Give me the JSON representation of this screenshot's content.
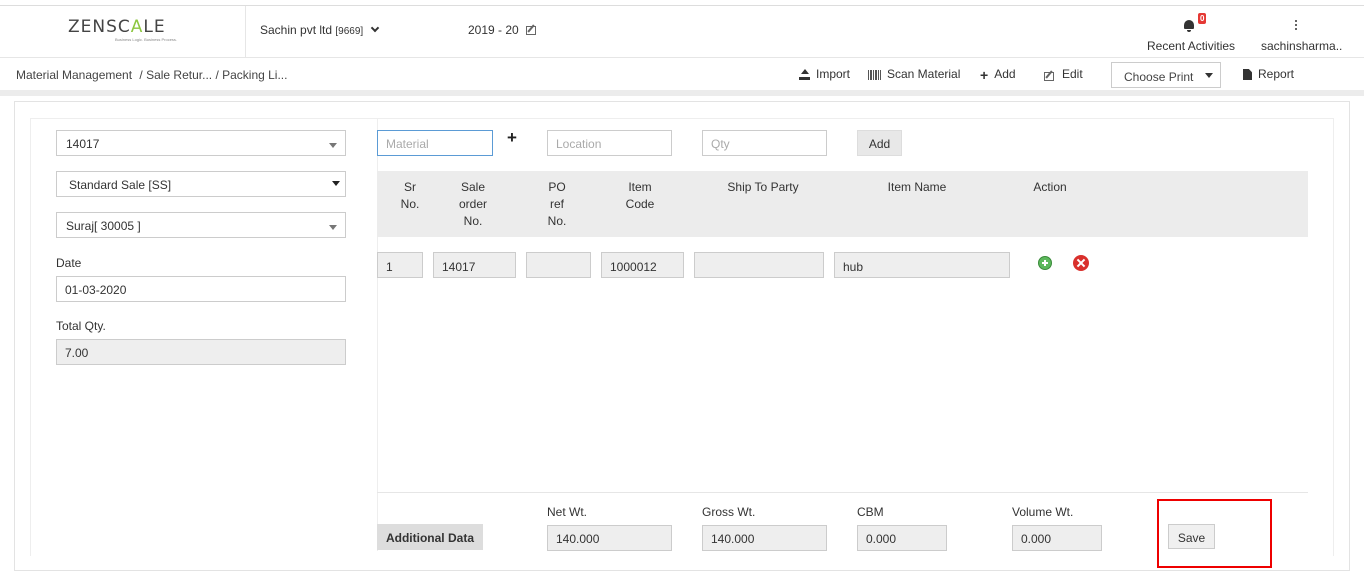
{
  "header": {
    "logo": {
      "part1": "ZENSC",
      "part2": "A",
      "part3": "LE",
      "tagline": "Business Logic. Business Process."
    },
    "company": {
      "name": "Sachin pvt ltd",
      "code": "[9669]"
    },
    "financial_year": "2019 - 20",
    "notifications": {
      "count": "0",
      "label": "Recent Activities"
    },
    "user": {
      "name": "sachinsharma.."
    }
  },
  "breadcrumb": {
    "item1": "Material Management",
    "item2": "/ Sale Retur... / Packing Li..."
  },
  "toolbar": {
    "import": "Import",
    "scan": "Scan Material",
    "add": "Add",
    "edit": "Edit",
    "print": "Choose Print",
    "report": "Report"
  },
  "left_form": {
    "doc_select": "14017",
    "sale_type": "Standard Sale [SS]",
    "party": "Suraj[ 30005 ]",
    "date_label": "Date",
    "date_value": "01-03-2020",
    "total_qty_label": "Total Qty.",
    "total_qty_value": "7.00"
  },
  "entry": {
    "material_placeholder": "Material",
    "location_placeholder": "Location",
    "qty_placeholder": "Qty",
    "add_label": "Add"
  },
  "table": {
    "headers": {
      "sr": "Sr No.",
      "sale_order": "Sale order No.",
      "po_ref": "PO ref No.",
      "item_code": "Item Code",
      "ship_to": "Ship To Party",
      "item_name": "Item Name",
      "action": "Action"
    },
    "rows": [
      {
        "sr": "1",
        "sale_order": "14017",
        "po_ref": "",
        "item_code": "1000012",
        "ship_to": "",
        "item_name": "hub"
      }
    ]
  },
  "footer": {
    "additional_data": "Additional Data",
    "net_wt_label": "Net Wt.",
    "net_wt": "140.000",
    "gross_wt_label": "Gross Wt.",
    "gross_wt": "140.000",
    "cbm_label": "CBM",
    "cbm": "0.000",
    "volume_wt_label": "Volume Wt.",
    "volume_wt": "0.000",
    "save": "Save"
  },
  "colors": {
    "accent_green": "#8cc63f",
    "highlight_red": "#e00000"
  }
}
